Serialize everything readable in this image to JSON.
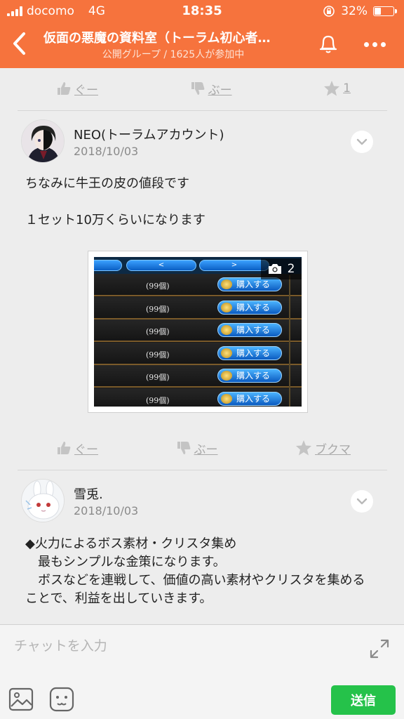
{
  "status_bar": {
    "carrier": "docomo",
    "network": "4G",
    "time": "18:35",
    "battery_percent": "32%",
    "battery_level": 0.32
  },
  "header": {
    "title": "仮面の悪魔の資料室（トーラム初心者…",
    "subtitle": "公開グループ / 1625人が参加中",
    "background_color": "#f6733d"
  },
  "top_actions": {
    "like_label": "ぐー",
    "dislike_label": "ぶー",
    "favorite_count": "1"
  },
  "posts": [
    {
      "author": "NEO(トーラムアカウント)",
      "date": "2018/10/03",
      "text": "ちなみに牛王の皮の値段です\n\n１セット10万くらいになります",
      "photo": {
        "count": "2",
        "tab_prev": "<",
        "tab_next": ">",
        "rows": [
          {
            "qty": "(99個)",
            "button": "購入する"
          },
          {
            "qty": "(99個)",
            "button": "購入する"
          },
          {
            "qty": "(99個)",
            "button": "購入する"
          },
          {
            "qty": "(99個)",
            "button": "購入する"
          },
          {
            "qty": "(99個)",
            "button": "購入する"
          },
          {
            "qty": "(99個)",
            "button": "購入する"
          }
        ]
      },
      "actions": {
        "like_label": "ぐー",
        "dislike_label": "ぶー",
        "bookmark_label": "ブクマ"
      }
    },
    {
      "author": "雪兎.",
      "date": "2018/10/03",
      "text": "◆火力によるボス素材・クリスタ集め\n　最もシンプルな金策になります。\n　ボスなどを連戦して、価値の高い素材やクリスタを集めることで、利益を出していきます。"
    }
  ],
  "footer": {
    "placeholder": "チャットを入力",
    "send_label": "送信",
    "send_color": "#25c24a"
  }
}
